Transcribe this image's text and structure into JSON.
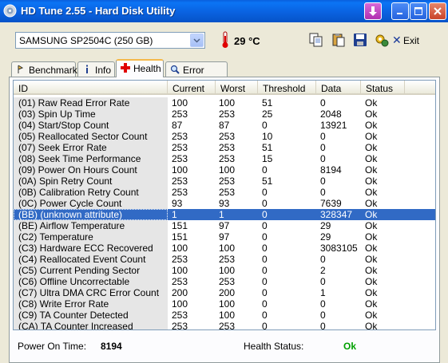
{
  "window": {
    "title": "HD Tune 2.55 - Hard Disk Utility"
  },
  "toolbar": {
    "drive": "SAMSUNG SP2504C (250 GB)",
    "temperature": "29 °C",
    "exit_label": "Exit"
  },
  "tabs": [
    {
      "label": "Benchmark",
      "active": false
    },
    {
      "label": "Info",
      "active": false
    },
    {
      "label": "Health",
      "active": true
    },
    {
      "label": "Error Scan",
      "active": false
    }
  ],
  "table": {
    "headers": [
      "ID",
      "Current",
      "Worst",
      "Threshold",
      "Data",
      "Status"
    ],
    "selected_row": 11,
    "rows": [
      [
        "(01) Raw Read Error Rate",
        "100",
        "100",
        "51",
        "0",
        "Ok"
      ],
      [
        "(03) Spin Up Time",
        "253",
        "253",
        "25",
        "2048",
        "Ok"
      ],
      [
        "(04) Start/Stop Count",
        "87",
        "87",
        "0",
        "13921",
        "Ok"
      ],
      [
        "(05) Reallocated Sector Count",
        "253",
        "253",
        "10",
        "0",
        "Ok"
      ],
      [
        "(07) Seek Error Rate",
        "253",
        "253",
        "51",
        "0",
        "Ok"
      ],
      [
        "(08) Seek Time Performance",
        "253",
        "253",
        "15",
        "0",
        "Ok"
      ],
      [
        "(09) Power On Hours Count",
        "100",
        "100",
        "0",
        "8194",
        "Ok"
      ],
      [
        "(0A) Spin Retry Count",
        "253",
        "253",
        "51",
        "0",
        "Ok"
      ],
      [
        "(0B) Calibration Retry Count",
        "253",
        "253",
        "0",
        "0",
        "Ok"
      ],
      [
        "(0C) Power Cycle Count",
        "93",
        "93",
        "0",
        "7639",
        "Ok"
      ],
      [
        "(BB) (unknown attribute)",
        "1",
        "1",
        "0",
        "328347",
        "Ok"
      ],
      [
        "(BE) Airflow Temperature",
        "151",
        "97",
        "0",
        "29",
        "Ok"
      ],
      [
        "(C2) Temperature",
        "151",
        "97",
        "0",
        "29",
        "Ok"
      ],
      [
        "(C3) Hardware ECC Recovered",
        "100",
        "100",
        "0",
        "3083105",
        "Ok"
      ],
      [
        "(C4) Reallocated Event Count",
        "253",
        "253",
        "0",
        "0",
        "Ok"
      ],
      [
        "(C5) Current Pending Sector",
        "100",
        "100",
        "0",
        "2",
        "Ok"
      ],
      [
        "(C6) Offline Uncorrectable",
        "253",
        "253",
        "0",
        "0",
        "Ok"
      ],
      [
        "(C7) Ultra DMA CRC Error Count",
        "200",
        "200",
        "0",
        "1",
        "Ok"
      ],
      [
        "(C8) Write Error Rate",
        "100",
        "100",
        "0",
        "0",
        "Ok"
      ],
      [
        "(C9) TA Counter Detected",
        "253",
        "100",
        "0",
        "0",
        "Ok"
      ],
      [
        "(CA) TA Counter Increased",
        "253",
        "253",
        "0",
        "0",
        "Ok"
      ]
    ]
  },
  "footer": {
    "power_on_label": "Power On Time:",
    "power_on_value": "8194",
    "health_label": "Health Status:",
    "health_value": "Ok",
    "health_color": "#00a000"
  },
  "colors": {
    "titlebar": "#0a5fdc",
    "selection": "#316ac5",
    "window_bg": "#ece9d8"
  }
}
